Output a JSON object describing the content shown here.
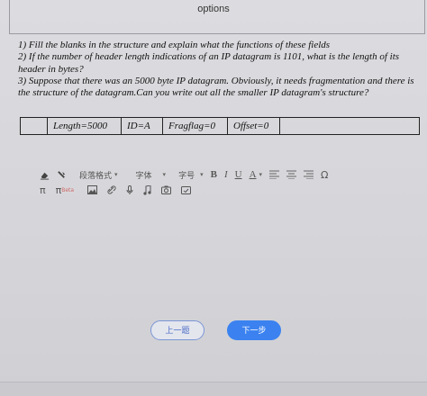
{
  "header": {
    "options_label": "options"
  },
  "question": {
    "lines": [
      "1) Fill the blanks in the structure and explain what the functions of these fields",
      "2) If the number of header length indications of an IP datagram is 1101, what is the length of its header in bytes?",
      "3) Suppose that there was an 5000 byte IP datagram. Obviously, it needs fragmentation and there is the structure of the datagram.Can you write out all the smaller IP datagram's structure?"
    ]
  },
  "datagram": {
    "cells": [
      "",
      "Length=5000",
      "ID=A",
      "Fragflag=0",
      "Offset=0",
      ""
    ]
  },
  "toolbar": {
    "paragraph_format": "段落格式",
    "font_family": "字体",
    "font_size": "字号",
    "bold": "B",
    "italic": "I",
    "underline": "U",
    "font_color": "A",
    "omega": "Ω",
    "pi": "π",
    "pi_beta": "π",
    "beta_label": "Beta"
  },
  "nav": {
    "prev_label": "上一题",
    "next_label": "下一步"
  },
  "colors": {
    "accent": "#3b82f0",
    "prev_border": "#7a96d6"
  }
}
